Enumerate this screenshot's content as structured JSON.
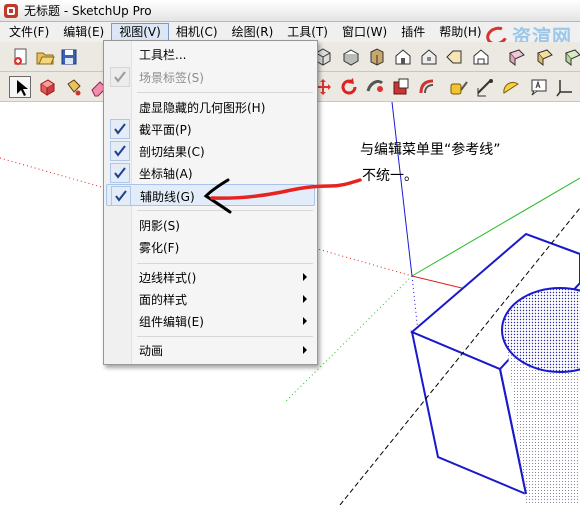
{
  "window": {
    "title": "无标题 - SketchUp Pro"
  },
  "menubar": {
    "items": [
      {
        "label": "文件(F)"
      },
      {
        "label": "编辑(E)"
      },
      {
        "label": "视图(V)"
      },
      {
        "label": "相机(C)"
      },
      {
        "label": "绘图(R)"
      },
      {
        "label": "工具(T)"
      },
      {
        "label": "窗口(W)"
      },
      {
        "label": "插件"
      },
      {
        "label": "帮助(H)"
      }
    ],
    "active": "视图(V)"
  },
  "watermark": {
    "text": "资渲网"
  },
  "view_menu": {
    "items": [
      {
        "label": "工具栏..."
      },
      {
        "label": "场景标签(S)",
        "checked": true,
        "disabled": true
      },
      {
        "label": "虚显隐藏的几何图形(H)"
      },
      {
        "label": "截平面(P)",
        "checked": true
      },
      {
        "label": "剖切结果(C)",
        "checked": true
      },
      {
        "label": "坐标轴(A)",
        "checked": true
      },
      {
        "label": "辅助线(G)",
        "checked": true,
        "highlighted": true
      },
      {
        "label": "阴影(S)"
      },
      {
        "label": "雾化(F)"
      },
      {
        "label": "边线样式()",
        "submenu": true
      },
      {
        "label": "面的样式",
        "submenu": true
      },
      {
        "label": "组件编辑(E)",
        "submenu": true
      },
      {
        "label": "动画",
        "submenu": true
      }
    ]
  },
  "annotation": {
    "line1": "与编辑菜单里“参考线”",
    "line2": "不统一。"
  },
  "colors": {
    "arrow_ink": "#000000",
    "red_stroke": "#e8231f",
    "axis_red": "#e02020",
    "axis_green": "#22bb22",
    "axis_blue": "#1a1ad6",
    "model_edge": "#1a1acc"
  },
  "icons": {
    "toolbar_row1": [
      "new-file-icon",
      "open-folder-icon",
      "save-icon",
      "iso-view-icon",
      "top-view-icon",
      "front-view-icon",
      "right-view-icon",
      "back-view-icon",
      "left-view-icon",
      "xray-icon",
      "wireframe-icon",
      "hidden-line-icon"
    ],
    "toolbar_row2": [
      "select-arrow-icon",
      "make-component-icon",
      "paint-bucket-icon",
      "eraser-icon",
      "orbit-icon",
      "push-pull-icon",
      "follow-me-icon",
      "offset-icon",
      "tape-measure-icon",
      "dimension-icon",
      "protractor-icon",
      "text-icon"
    ]
  }
}
